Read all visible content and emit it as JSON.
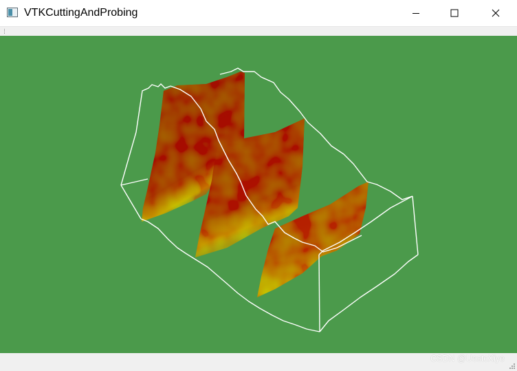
{
  "window": {
    "title": "VTKCuttingAndProbing",
    "controls": [
      "minimize",
      "maximize",
      "close"
    ]
  },
  "viewport": {
    "background_color": "#4b9a4b",
    "outline_color": "#ffffff",
    "colormap": [
      "#0a5fa8",
      "#00a080",
      "#3fb24a",
      "#c8c800",
      "#d8a000",
      "#c03000",
      "#8b0000"
    ],
    "planes": 3
  },
  "watermark": "CSDN @UestcXiye"
}
